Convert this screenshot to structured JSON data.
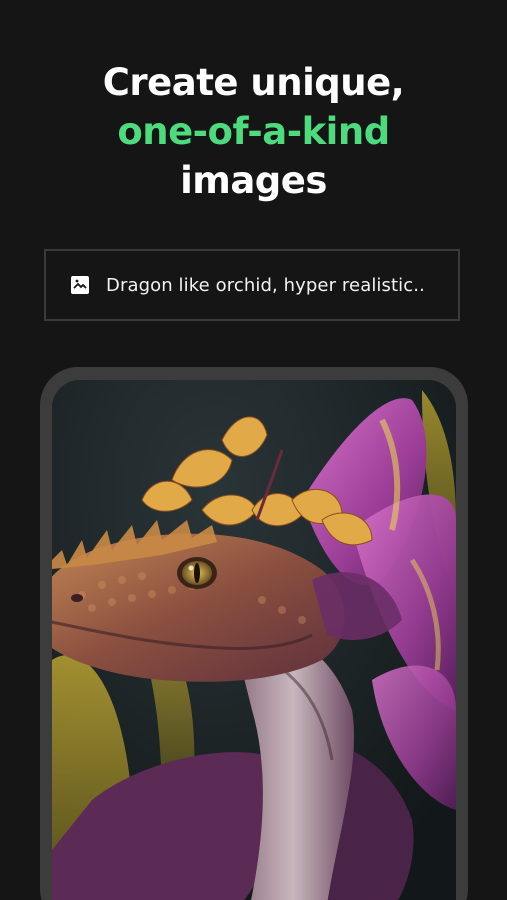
{
  "headline": {
    "line1": "Create unique,",
    "line2": "one-of-a-kind",
    "line3": "images"
  },
  "prompt": {
    "icon": "image-icon",
    "text": "Dragon like orchid, hyper realistic.."
  },
  "preview": {
    "subject": "dragon-orchid-image"
  },
  "colors": {
    "background": "#151515",
    "accent": "#4ddb7e",
    "frame": "#3c3c3c",
    "prompt_border": "#3a3a3a"
  }
}
